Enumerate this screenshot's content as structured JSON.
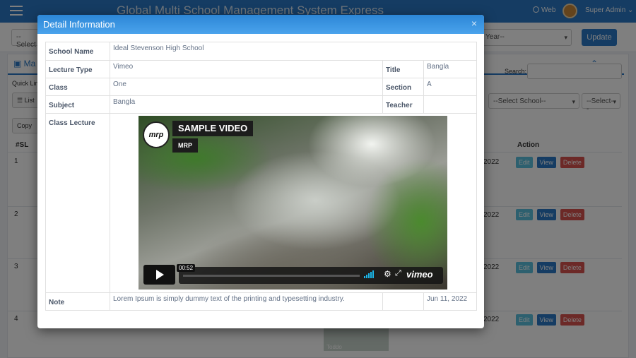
{
  "app": {
    "title": "Global Multi School Management System Express",
    "web_link": "Web",
    "user": "Super Admin",
    "user_caret": "⌄"
  },
  "filters": {
    "school_select": "--Select",
    "year_select": "Year--",
    "update_button": "Update",
    "caret": "▾"
  },
  "panel": {
    "title": "Ma",
    "collapse_icon": "⌃",
    "quick_links": "Quick Lin",
    "list_button": "List",
    "copy_button": "Copy",
    "school_filter": "--Select School--",
    "select_filter": "--Select--",
    "search_label": "Search:",
    "columns": {
      "sl": "#SL",
      "action": "Action"
    },
    "rows": [
      {
        "num": "1",
        "date": "2022"
      },
      {
        "num": "2",
        "date": "2022"
      },
      {
        "num": "3",
        "date": "2022"
      },
      {
        "num": "4",
        "date": "2022"
      }
    ],
    "actions": {
      "edit": "Edit",
      "view": "View",
      "delete": "Delete"
    },
    "thumb_caption": "Toddo"
  },
  "modal": {
    "title": "Detail Information",
    "close": "×",
    "labels": {
      "school_name": "School Name",
      "lecture_type": "Lecture Type",
      "title": "Title",
      "class": "Class",
      "section": "Section",
      "subject": "Subject",
      "teacher": "Teacher",
      "class_lecture": "Class Lecture",
      "note": "Note"
    },
    "values": {
      "school_name": "Ideal Stevenson High School",
      "lecture_type": "Vimeo",
      "title": "Bangla",
      "class": "One",
      "section": "A",
      "subject": "Bangla",
      "teacher": "",
      "note": "Lorem Ipsum is simply dummy text of the printing and typesetting industry.",
      "date": "Jun 11, 2022"
    },
    "video": {
      "logo_text": "mrp",
      "title": "SAMPLE VIDEO",
      "author": "MRP",
      "time": "00:52",
      "brand": "vimeo",
      "settings_icon": "⚙",
      "fullscreen_icon": "⤢"
    }
  }
}
